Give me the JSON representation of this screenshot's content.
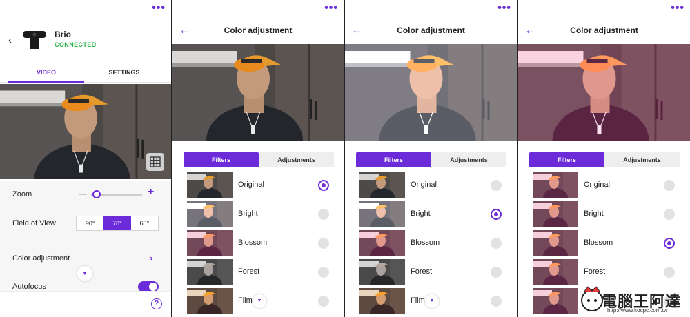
{
  "device": {
    "name": "Brio",
    "status": "CONNECTED",
    "status_color": "#2bb34b"
  },
  "tabs": [
    {
      "label": "VIDEO",
      "active": true
    },
    {
      "label": "SETTINGS",
      "active": false
    }
  ],
  "settings": {
    "zoom_label": "Zoom",
    "zoom_minus": "—",
    "zoom_plus": "+",
    "fov_label": "Field of View",
    "fov_options": [
      "90°",
      "78°",
      "65°"
    ],
    "fov_selected": "78°",
    "color_adjustment_label": "Color adjustment",
    "autofocus_label": "Autofocus",
    "autofocus_on": true,
    "help_symbol": "?"
  },
  "color_adjustment": {
    "title": "Color adjustment",
    "segment_filters": "Filters",
    "segment_adjustments": "Adjustments",
    "filters": [
      "Original",
      "Bright",
      "Blossom",
      "Forest",
      "Film"
    ],
    "selected_by_panel": [
      "Original",
      "Bright",
      "Blossom"
    ]
  },
  "watermark": {
    "text": "電腦王阿達",
    "url": "http://www.kocpc.com.tw"
  },
  "colors": {
    "accent": "#6b2bd9",
    "connected": "#2bb34b"
  },
  "icons": [
    "back-chevron-icon",
    "webcam-icon",
    "more-dots-icon",
    "grid-icon",
    "chevron-right-icon",
    "chevron-down-icon",
    "help-icon",
    "back-arrow-icon"
  ]
}
